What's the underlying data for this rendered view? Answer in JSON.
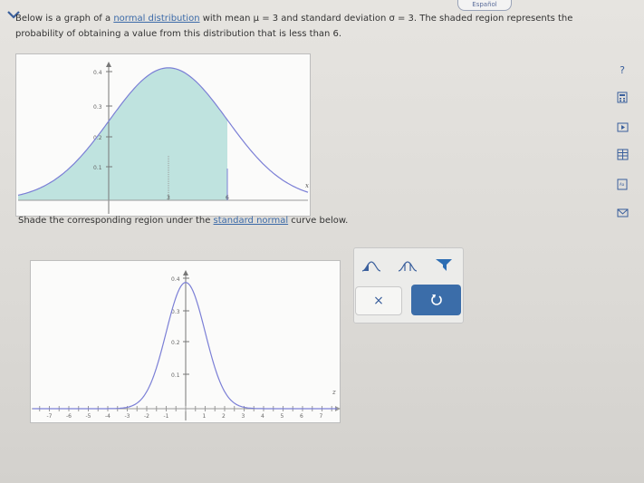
{
  "header": {
    "language_button": "Español"
  },
  "question": {
    "part1": "Below is a graph of a ",
    "link1": "normal distribution",
    "part2": " with mean μ = 3 and standard deviation σ = 3. The shaded region represents the probability of obtaining a value from this distribution that is less than 6.",
    "part3": "Shade the corresponding region under the ",
    "link2": "standard normal",
    "part4": " curve below."
  },
  "graph1": {
    "y_ticks": [
      "0.4",
      "0.3",
      "0.2",
      "0.1"
    ],
    "x_labels": [
      "3",
      "6"
    ],
    "axis_label": "x"
  },
  "graph2": {
    "y_ticks": [
      "0.4",
      "0.3",
      "0.2",
      "0.1"
    ],
    "x_labels": [
      "-7",
      "-6",
      "-5",
      "-4",
      "-3",
      "-2",
      "-1",
      "1",
      "2",
      "3",
      "4",
      "5",
      "6",
      "7"
    ],
    "axis_label": "z"
  },
  "tools": {
    "clear_symbol": "×"
  },
  "sidebar": {
    "help_symbol": "?"
  },
  "colors": {
    "shade": "#bfe3df",
    "curve": "#7b7fd6",
    "link": "#3b6aa8",
    "button_blue": "#3b6da9"
  },
  "chart_data": [
    {
      "type": "area",
      "description_of_content": "normal curve",
      "mean": 3,
      "sd": 3,
      "shaded_upper_x": 6,
      "y_ticks": [
        0.1,
        0.2,
        0.3,
        0.4
      ],
      "xlabel": "x"
    },
    {
      "type": "line",
      "mean": 0,
      "sd": 1,
      "x_ticks": [
        -7,
        -6,
        -5,
        -4,
        -3,
        -2,
        -1,
        1,
        2,
        3,
        4,
        5,
        6,
        7
      ],
      "y_ticks": [
        0.1,
        0.2,
        0.3,
        0.4
      ],
      "xlabel": "z"
    }
  ]
}
